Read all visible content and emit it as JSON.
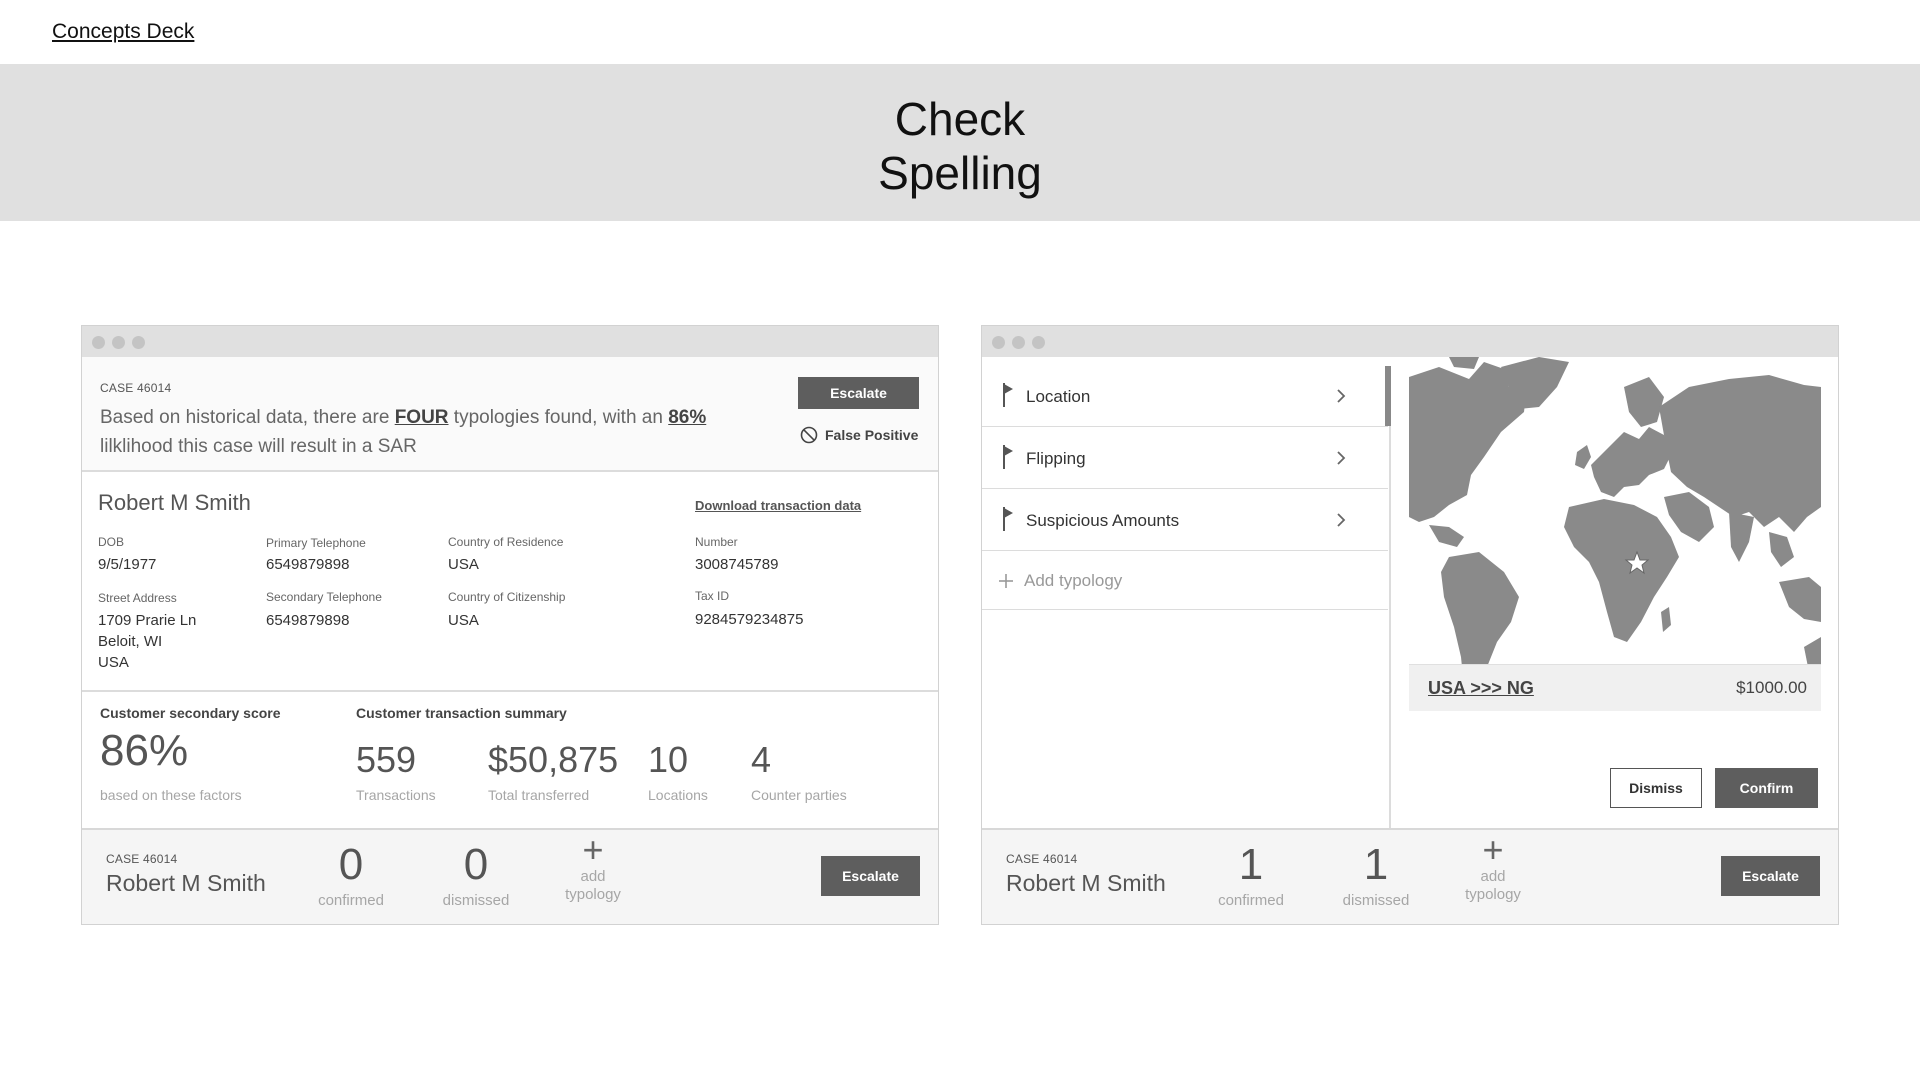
{
  "top_link": "Concepts Deck",
  "banner": {
    "line1": "Check",
    "line2": "Spelling"
  },
  "left": {
    "case_label": "CASE 46014",
    "summary": {
      "part1": "Based on historical data, there are ",
      "highlight1": "FOUR",
      "part2": " typologies found, with an ",
      "highlight2": "86%",
      "line2": "lilklihood this case will result in a SAR"
    },
    "escalate_label": "Escalate",
    "false_positive_label": "False Positive",
    "name": "Robert M Smith",
    "download_label": "Download transaction data",
    "fields": {
      "dob_label": "DOB",
      "dob": "9/5/1977",
      "primary_tel_label": "Primary Telephone",
      "primary_tel": "6549879898",
      "country_res_label": "Country of Residence",
      "country_res": "USA",
      "number_label": "Number",
      "number": "3008745789",
      "street_label": "Street Address",
      "street1": "1709 Prarie Ln",
      "street2": "Beloit, WI",
      "street3": "USA",
      "secondary_tel_label": "Secondary Telephone",
      "secondary_tel": "6549879898",
      "country_cit_label": "Country of Citizenship",
      "country_cit": "USA",
      "tax_label": "Tax ID",
      "tax": "9284579234875"
    },
    "score": {
      "title": "Customer secondary score",
      "value": "86%",
      "sub": "based on these factors"
    },
    "summary_stats": {
      "title": "Customer transaction summary",
      "items": [
        {
          "value": "559",
          "label": "Transactions"
        },
        {
          "value": "$50,875",
          "label": "Total transferred"
        },
        {
          "value": "10",
          "label": "Locations"
        },
        {
          "value": "4",
          "label": "Counter parties"
        }
      ]
    },
    "footer": {
      "case_label": "CASE 46014",
      "name": "Robert M Smith",
      "confirmed": "0",
      "confirmed_label": "confirmed",
      "dismissed": "0",
      "dismissed_label": "dismissed",
      "add_symbol": "+",
      "add_label1": "add",
      "add_label2": "typology",
      "escalate_label": "Escalate"
    }
  },
  "right": {
    "typologies": [
      "Location",
      "Flipping",
      "Suspicious Amounts"
    ],
    "add_typology": "Add typology",
    "route": "USA >>> NG",
    "amount": "$1000.00",
    "dismiss_label": "Dismiss",
    "confirm_label": "Confirm",
    "footer": {
      "case_label": "CASE 46014",
      "name": "Robert M Smith",
      "confirmed": "1",
      "confirmed_label": "confirmed",
      "dismissed": "1",
      "dismissed_label": "dismissed",
      "add_symbol": "+",
      "add_label1": "add",
      "add_label2": "typology",
      "escalate_label": "Escalate"
    }
  },
  "colors": {
    "banner": "#e0e0e0",
    "button": "#5e5e5e",
    "map_land": "#8a8a8a"
  }
}
